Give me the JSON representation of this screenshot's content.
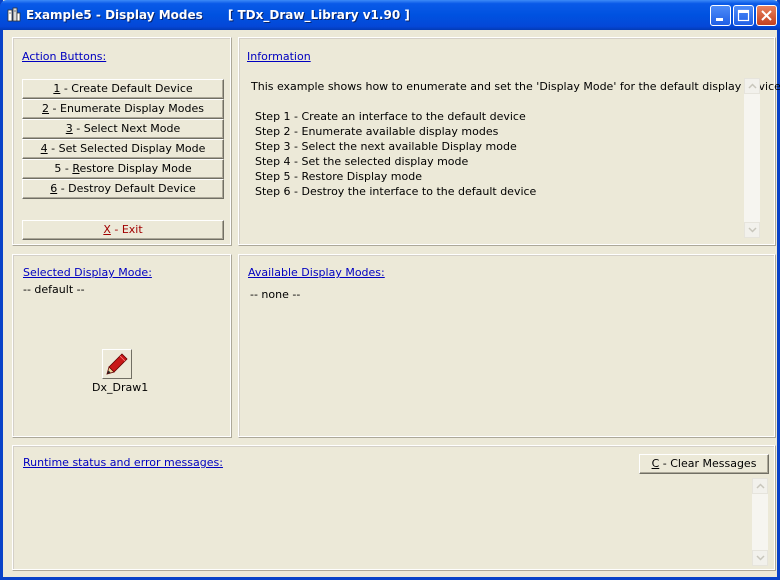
{
  "window": {
    "title": "Example5 - Display Modes      [ TDx_Draw_Library v1.90 ]",
    "icon": "app-icon",
    "controls": [
      "minimize-icon",
      "maximize-icon",
      "close-icon"
    ]
  },
  "action_panel": {
    "title": "Action Buttons:",
    "buttons": [
      {
        "key": "1",
        "label": " - Create Default Device"
      },
      {
        "key": "2",
        "label": " - Enumerate Display Modes"
      },
      {
        "key": "3",
        "label": " - Select Next Mode"
      },
      {
        "key": "4",
        "label": " - Set Selected Display Mode"
      },
      {
        "prefix": "5 - ",
        "key": "R",
        "label": "estore Display Mode"
      },
      {
        "key": "6",
        "label": " - Destroy Default Device"
      }
    ],
    "exit": {
      "key": "X",
      "label": " - Exit"
    }
  },
  "info_panel": {
    "title": "Information",
    "lines": [
      "This example shows how to enumerate and set the 'Display Mode' for the default display device.",
      "",
      "Step 1 - Create an interface to the default device",
      "Step 2 - Enumerate available display modes",
      "Step 3 - Select the next available Display mode",
      "Step 4 - Set the selected display mode",
      "Step 5 - Restore Display mode",
      "Step 6 - Destroy the interface to the default device"
    ]
  },
  "selected_panel": {
    "title": "Selected Display Mode:",
    "value": "-- default --",
    "component_label": "Dx_Draw1",
    "component_icon": "pencil-icon"
  },
  "available_panel": {
    "title": "Available Display Modes:",
    "value": "-- none --"
  },
  "status_panel": {
    "title": "Runtime status and error messages:",
    "clear_key": "C",
    "clear_label": " - Clear Messages"
  }
}
